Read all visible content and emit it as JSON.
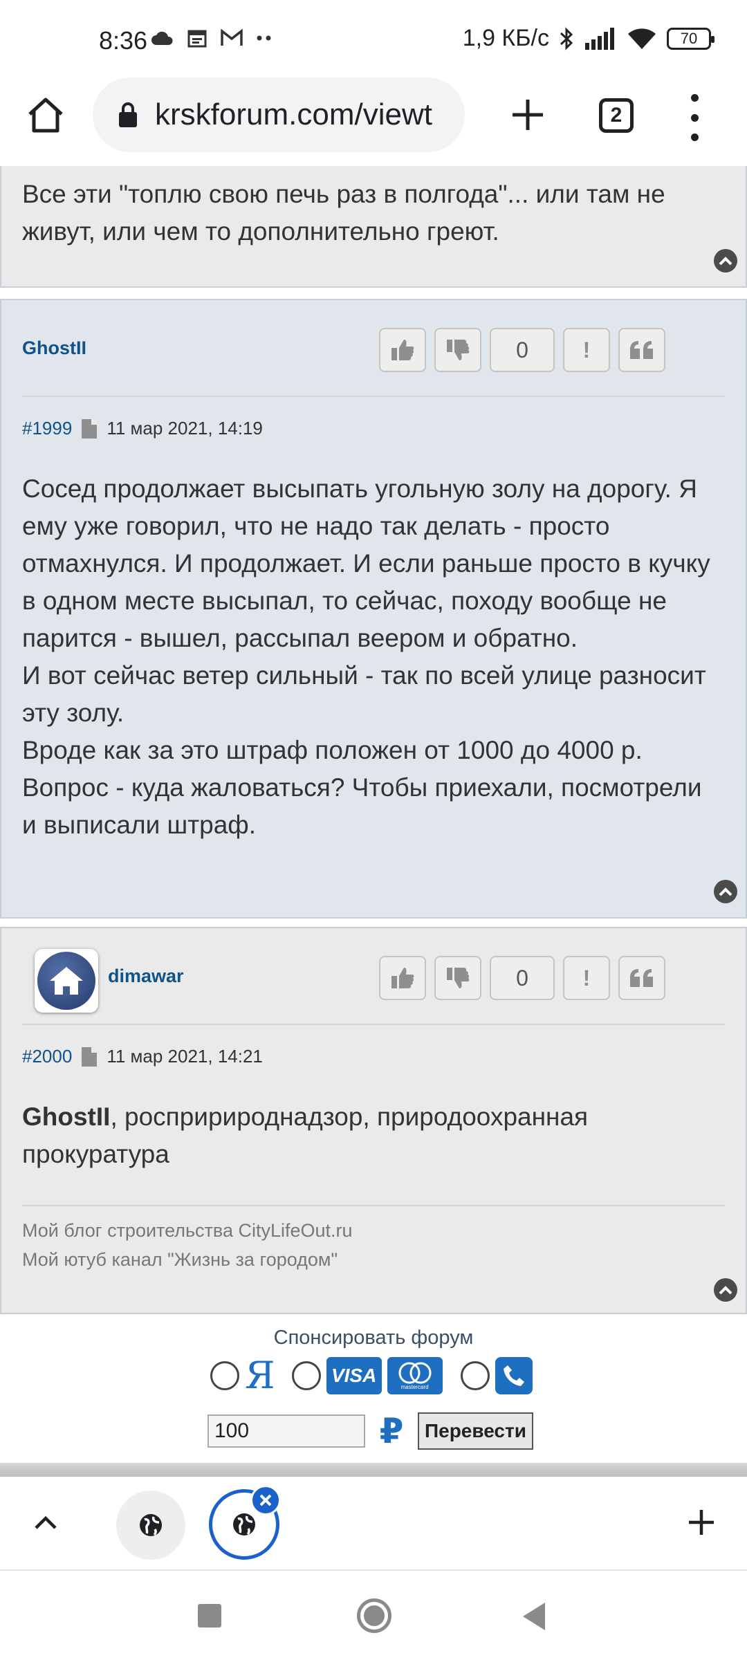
{
  "status_bar": {
    "time": "8:36",
    "network_speed": "1,9 КБ/с",
    "battery": "70"
  },
  "browser": {
    "url": "krskforum.com/viewt",
    "tab_count": "2"
  },
  "posts": [
    {
      "text": "Все эти \"топлю свою печь раз в полгода\"... или там не живут, или чем то дополнительно греют."
    },
    {
      "author": "GhostII",
      "vote_count": "0",
      "post_number": "#1999",
      "date": "11 мар 2021, 14:19",
      "paragraphs": [
        "Сосед продолжает высыпать угольную золу на дорогу. Я ему уже говорил, что не надо так делать - просто отмахнулся. И продолжает. И если раньше просто в кучку в одном месте высыпал, то сейчас, походу вообще не парится - вышел, рассыпал веером и обратно.",
        "И вот сейчас ветер сильный - так по всей улице разносит эту золу.",
        "Вроде как за это штраф положен от 1000 до 4000 р.",
        "Вопрос - куда жаловаться? Чтобы приехали, посмотрели и выписали штраф."
      ]
    },
    {
      "author": "dimawar",
      "vote_count": "0",
      "post_number": "#2000",
      "date": "11 мар 2021, 14:21",
      "mention": "GhostII",
      "text": ", роспририроднадзор, природоохранная прокуратура",
      "signature": [
        "Мой блог строительства CityLifeOut.ru",
        "Мой ютуб канал \"Жизнь за городом\""
      ]
    }
  ],
  "sponsor": {
    "title": "Спонсировать форум",
    "yandex_glyph": "Я",
    "visa_label": "VISA",
    "mastercard_label": "mastercard",
    "amount": "100",
    "currency_symbol": "₽",
    "transfer_label": "Перевести"
  },
  "icons": {
    "like": "thumbs-up-icon",
    "dislike": "thumbs-down-icon",
    "report": "exclamation-icon",
    "quote": "quote-icon",
    "scroll_top": "chevron-up-circle-icon"
  },
  "colors": {
    "author": "#105289",
    "accent": "#1a62c9",
    "post_bg_blue": "#e0e6ec",
    "post_bg_gray": "#eaeaea"
  }
}
